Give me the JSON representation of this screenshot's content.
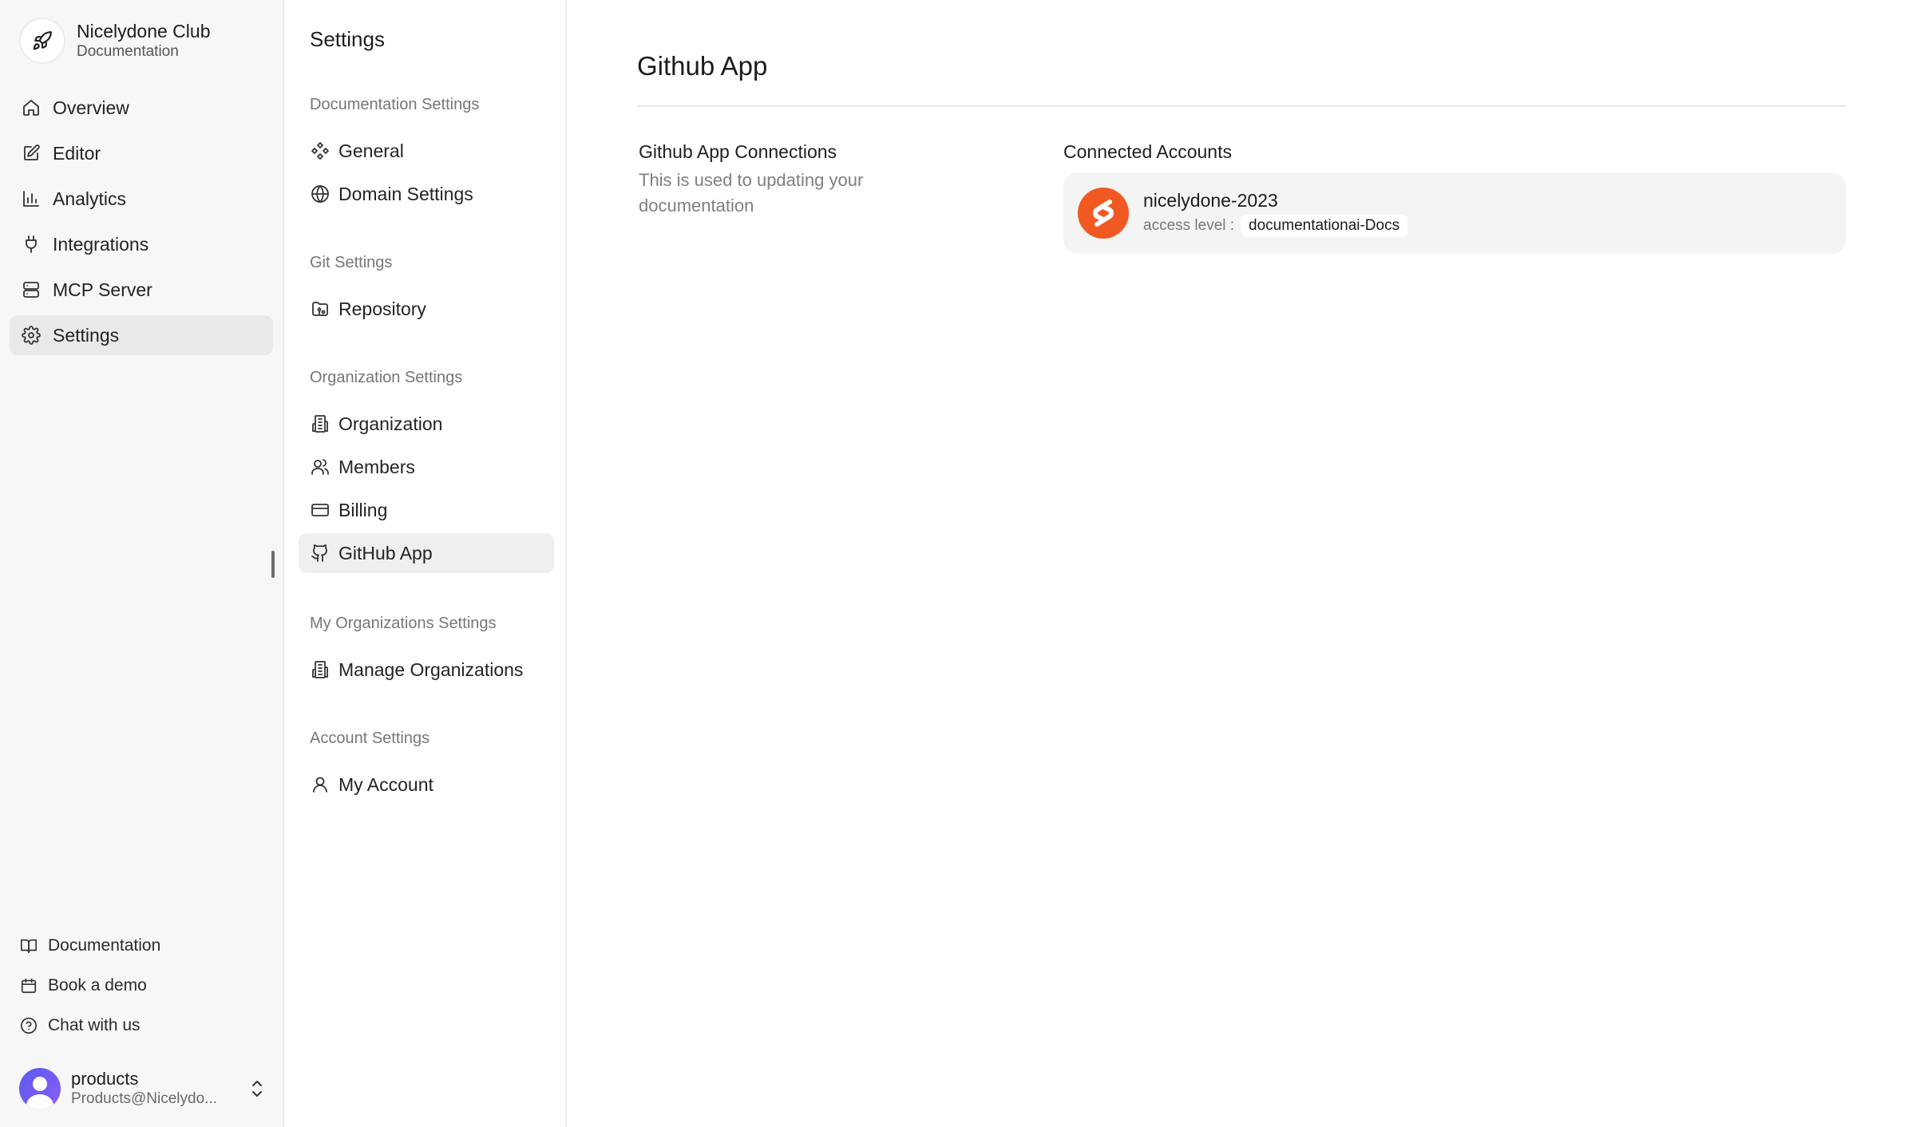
{
  "app": {
    "org_name": "Nicelydone Club",
    "org_subtitle": "Documentation",
    "nav": [
      {
        "label": "Overview",
        "icon": "home-icon"
      },
      {
        "label": "Editor",
        "icon": "edit-icon"
      },
      {
        "label": "Analytics",
        "icon": "bar-chart-icon"
      },
      {
        "label": "Integrations",
        "icon": "plug-icon"
      },
      {
        "label": "MCP Server",
        "icon": "server-icon"
      },
      {
        "label": "Settings",
        "icon": "gear-icon",
        "active": true
      }
    ],
    "footer_links": [
      {
        "label": "Documentation",
        "icon": "book-icon"
      },
      {
        "label": "Book a demo",
        "icon": "calendar-icon"
      },
      {
        "label": "Chat with us",
        "icon": "help-circle-icon"
      }
    ],
    "user": {
      "name": "products",
      "email": "Products@Nicelydo..."
    }
  },
  "settings": {
    "title": "Settings",
    "groups": [
      {
        "label": "Documentation Settings",
        "items": [
          {
            "label": "General",
            "icon": "components-icon"
          },
          {
            "label": "Domain Settings",
            "icon": "globe-icon"
          }
        ]
      },
      {
        "label": "Git Settings",
        "items": [
          {
            "label": "Repository",
            "icon": "folder-git-icon"
          }
        ]
      },
      {
        "label": "Organization Settings",
        "items": [
          {
            "label": "Organization",
            "icon": "building-icon"
          },
          {
            "label": "Members",
            "icon": "users-icon"
          },
          {
            "label": "Billing",
            "icon": "credit-card-icon"
          },
          {
            "label": "GitHub App",
            "icon": "github-icon",
            "active": true
          }
        ]
      },
      {
        "label": "My Organizations Settings",
        "items": [
          {
            "label": "Manage Organizations",
            "icon": "building-icon"
          }
        ]
      },
      {
        "label": "Account Settings",
        "items": [
          {
            "label": "My Account",
            "icon": "user-icon"
          }
        ]
      }
    ]
  },
  "main": {
    "title": "Github App",
    "connections_heading": "Github App Connections",
    "connections_desc": "This is used to updating your documentation",
    "connected_heading": "Connected Accounts",
    "account": {
      "name": "nicelydone-2023",
      "access_label": "access level :",
      "access_value": "documentationai-Docs",
      "logo_color": "#f05a22"
    }
  },
  "colors": {
    "accent_orange": "#f05a22",
    "avatar_purple": "#5b5bf0",
    "active_bg": "#e9e9e9"
  }
}
